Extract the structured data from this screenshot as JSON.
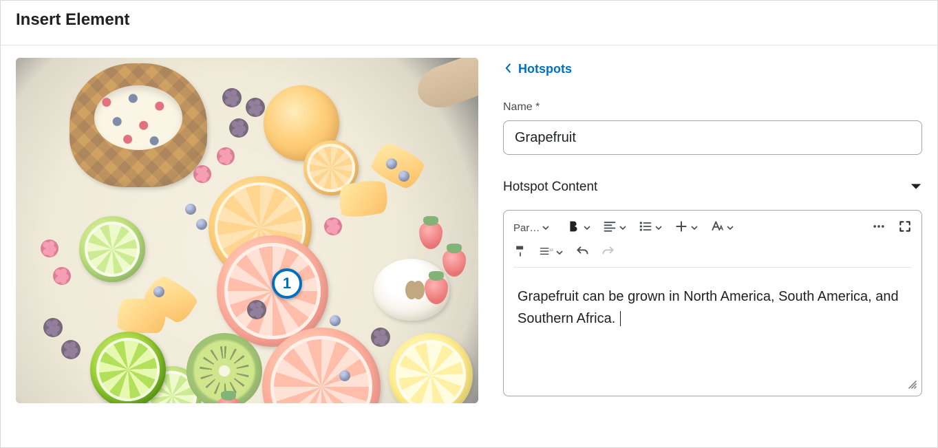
{
  "header": {
    "title": "Insert Element"
  },
  "back": {
    "label": "Hotspots"
  },
  "hotspots": {
    "markers": [
      {
        "number": "1"
      }
    ],
    "name_label": "Name *",
    "name_value": "Grapefruit",
    "content_label": "Hotspot Content",
    "content_body": "Grapefruit can be grown in North America, South America, and Southern Africa."
  },
  "editor": {
    "paragraph_label": "Par…"
  }
}
